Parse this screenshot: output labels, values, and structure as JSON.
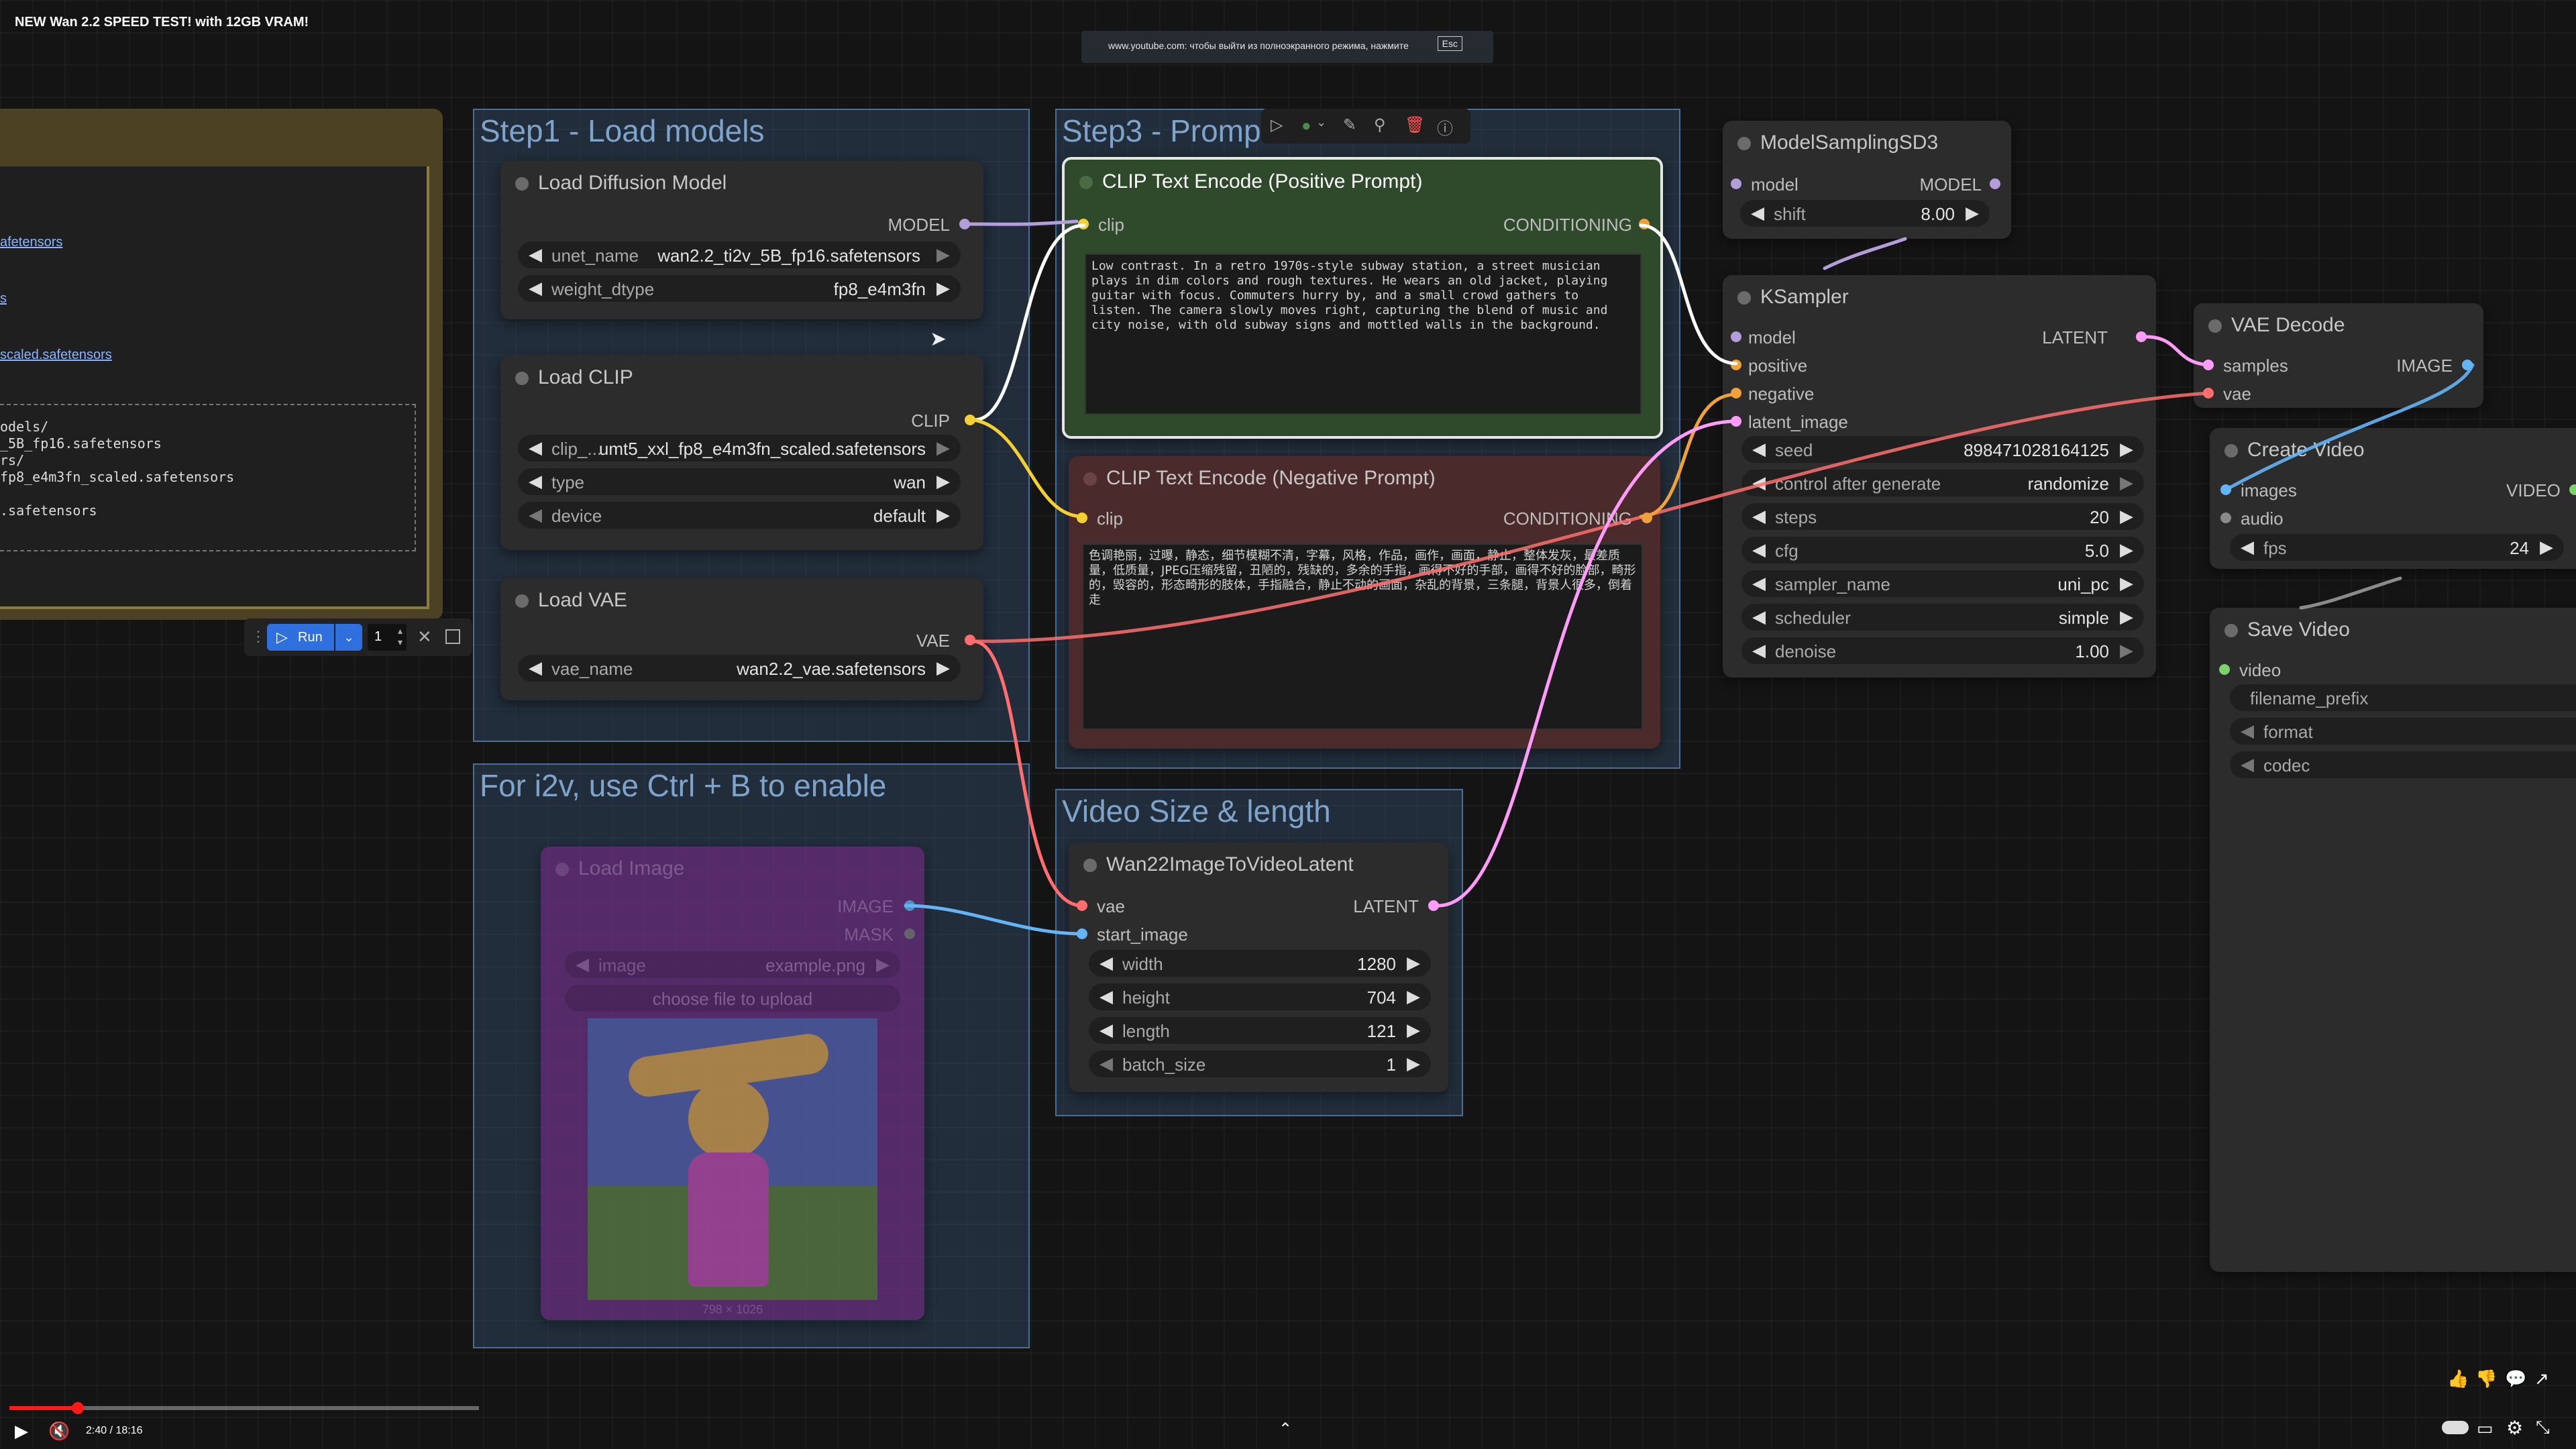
{
  "video": {
    "title": "NEW Wan 2.2 SPEED TEST! with 12GB VRAM!",
    "fullscreen_notice": "www.youtube.com: чтобы выйти из полноэкранного режима, нажмите",
    "esc_key": "Esc",
    "time": "2:40 / 18:16",
    "progress": 0.146
  },
  "left_note": {
    "links": [
      "afetensors",
      "s",
      "scaled.safetensors"
    ],
    "code_lines": [
      "odels/",
      "_5B_fp16.safetensors",
      "rs/",
      "fp8_e4m3fn_scaled.safetensors",
      "",
      ".safetensors"
    ]
  },
  "run_toolbar": {
    "run_label": "Run",
    "count": "1"
  },
  "groups": {
    "step1": "Step1 - Load models",
    "step3": "Step3 - Promp",
    "i2v": "For i2v, use Ctrl + B to enable",
    "video_size": "Video Size & length"
  },
  "nodes": {
    "load_diffusion": {
      "title": "Load Diffusion Model",
      "output": "MODEL",
      "w1_label": "unet_name",
      "w1_value": "wan2.2_ti2v_5B_fp16.safetensors",
      "w2_label": "weight_dtype",
      "w2_value": "fp8_e4m3fn"
    },
    "load_clip": {
      "title": "Load CLIP",
      "output": "CLIP",
      "w1_label": "clip_...",
      "w1_value": "umt5_xxl_fp8_e4m3fn_scaled.safetensors",
      "w2_label": "type",
      "w2_value": "wan",
      "w3_label": "device",
      "w3_value": "default"
    },
    "load_vae": {
      "title": "Load VAE",
      "output": "VAE",
      "w1_label": "vae_name",
      "w1_value": "wan2.2_vae.safetensors"
    },
    "load_image": {
      "title": "Load Image",
      "out1": "IMAGE",
      "out2": "MASK",
      "w1_label": "image",
      "w1_value": "example.png",
      "upload": "choose file to upload",
      "caption": "798 × 1026"
    },
    "clip_pos": {
      "title": "CLIP Text Encode (Positive Prompt)",
      "input": "clip",
      "output": "CONDITIONING",
      "text": "Low contrast. In a retro 1970s-style subway station, a street musician plays in dim colors and rough textures. He wears an old jacket, playing guitar with focus. Commuters hurry by, and a small crowd gathers to listen. The camera slowly moves right, capturing the blend of music and city noise, with old subway signs and mottled walls in the background."
    },
    "clip_neg": {
      "title": "CLIP Text Encode (Negative Prompt)",
      "input": "clip",
      "output": "CONDITIONING",
      "text": "色调艳丽，过曝，静态，细节模糊不清，字幕，风格，作品，画作，画面，静止，整体发灰，最差质量，低质量，JPEG压缩残留，丑陋的，残缺的，多余的手指，画得不好的手部，画得不好的脸部，畸形的，毁容的，形态畸形的肢体，手指融合，静止不动的画面，杂乱的背景，三条腿，背景人很多，倒着走"
    },
    "wan_latent": {
      "title": "Wan22ImageToVideoLatent",
      "in1": "vae",
      "in2": "start_image",
      "output": "LATENT",
      "widgets": [
        {
          "label": "width",
          "value": "1280"
        },
        {
          "label": "height",
          "value": "704"
        },
        {
          "label": "length",
          "value": "121"
        },
        {
          "label": "batch_size",
          "value": "1"
        }
      ]
    },
    "model_sampling": {
      "title": "ModelSamplingSD3",
      "input": "model",
      "output": "MODEL",
      "w1_label": "shift",
      "w1_value": "8.00"
    },
    "ksampler": {
      "title": "KSampler",
      "output": "LATENT",
      "inputs": [
        "model",
        "positive",
        "negative",
        "latent_image"
      ],
      "widgets": [
        {
          "label": "seed",
          "value": "898471028164125"
        },
        {
          "label": "control after generate",
          "value": "randomize"
        },
        {
          "label": "steps",
          "value": "20"
        },
        {
          "label": "cfg",
          "value": "5.0"
        },
        {
          "label": "sampler_name",
          "value": "uni_pc"
        },
        {
          "label": "scheduler",
          "value": "simple"
        },
        {
          "label": "denoise",
          "value": "1.00"
        }
      ]
    },
    "vae_decode": {
      "title": "VAE Decode",
      "in1": "samples",
      "in2": "vae",
      "output": "IMAGE"
    },
    "create_video": {
      "title": "Create Video",
      "in1": "images",
      "in2": "audio",
      "output": "VIDEO",
      "w1_label": "fps",
      "w1_value": "24"
    },
    "save_video": {
      "title": "Save Video",
      "in1": "video",
      "widgets": [
        "filename_prefix",
        "format",
        "codec"
      ]
    }
  },
  "colors": {
    "model": "#b39ddb",
    "clip": "#f5d033",
    "conditioning": "#f0a13a",
    "vae": "#ff6e6e",
    "latent": "#ff9cf9",
    "image": "#64b5f6",
    "video": "#7bd36a"
  }
}
